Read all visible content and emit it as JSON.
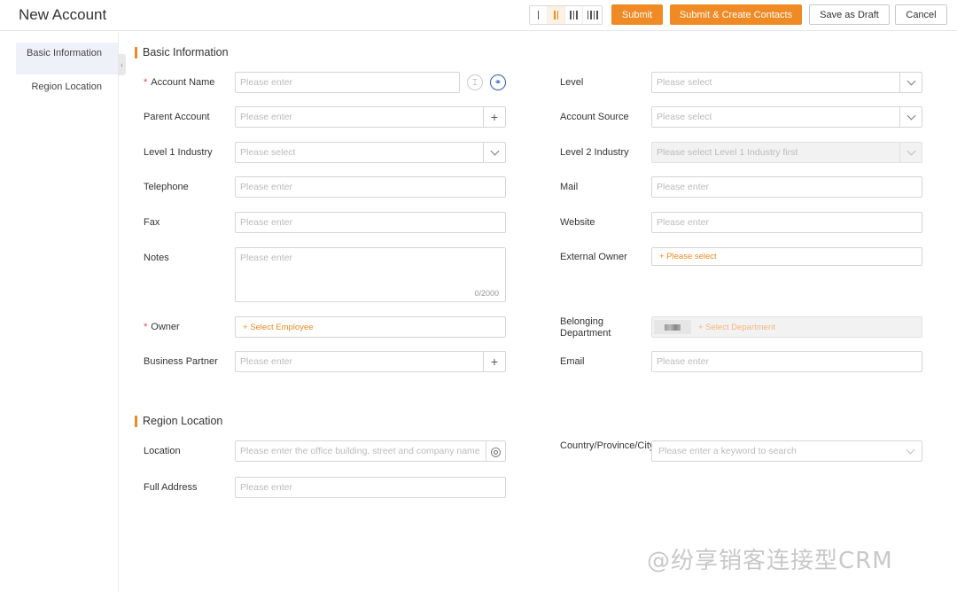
{
  "header": {
    "title": "New Account",
    "layout_options": [
      "one-column-icon",
      "two-column-icon",
      "three-column-icon",
      "four-column-icon"
    ],
    "active_layout": "two-column-icon",
    "submit_label": "Submit",
    "submit_create_label": "Submit & Create Contacts",
    "draft_label": "Save as Draft",
    "cancel_label": "Cancel"
  },
  "sidebar": {
    "items": [
      {
        "label": "Basic Information",
        "active": true
      },
      {
        "label": "Region Location",
        "active": false
      }
    ]
  },
  "sections": {
    "basic": "Basic Information",
    "region": "Region Location"
  },
  "fields": {
    "account_name": {
      "label": "Account Name",
      "placeholder": "Please enter",
      "required": true
    },
    "level": {
      "label": "Level",
      "placeholder": "Please select"
    },
    "parent_account": {
      "label": "Parent Account",
      "placeholder": "Please enter"
    },
    "account_source": {
      "label": "Account Source",
      "placeholder": "Please select"
    },
    "level1_industry": {
      "label": "Level 1 Industry",
      "placeholder": "Please select"
    },
    "level2_industry": {
      "label": "Level 2 Industry",
      "placeholder": "Please select Level 1 Industry first"
    },
    "telephone": {
      "label": "Telephone",
      "placeholder": "Please enter"
    },
    "mail": {
      "label": "Mail",
      "placeholder": "Please enter"
    },
    "fax": {
      "label": "Fax",
      "placeholder": "Please enter"
    },
    "website": {
      "label": "Website",
      "placeholder": "Please enter"
    },
    "notes": {
      "label": "Notes",
      "placeholder": "Please enter",
      "counter": "0/2000"
    },
    "external_owner": {
      "label": "External Owner",
      "action": "+ Please select"
    },
    "owner": {
      "label": "Owner",
      "action": "+ Select Employee",
      "required": true
    },
    "belonging_department": {
      "label": "Belonging Department",
      "action": "+ Select Department"
    },
    "business_partner": {
      "label": "Business Partner",
      "placeholder": "Please enter"
    },
    "email": {
      "label": "Email",
      "placeholder": "Please enter"
    },
    "location": {
      "label": "Location",
      "placeholder": "Please enter the office building, street and company name"
    },
    "country": {
      "label": "Country/Province/City/District",
      "placeholder": "Please enter a keyword to search"
    },
    "full_address": {
      "label": "Full Address",
      "placeholder": "Please enter"
    }
  },
  "watermark": "@纷享销客连接型CRM"
}
